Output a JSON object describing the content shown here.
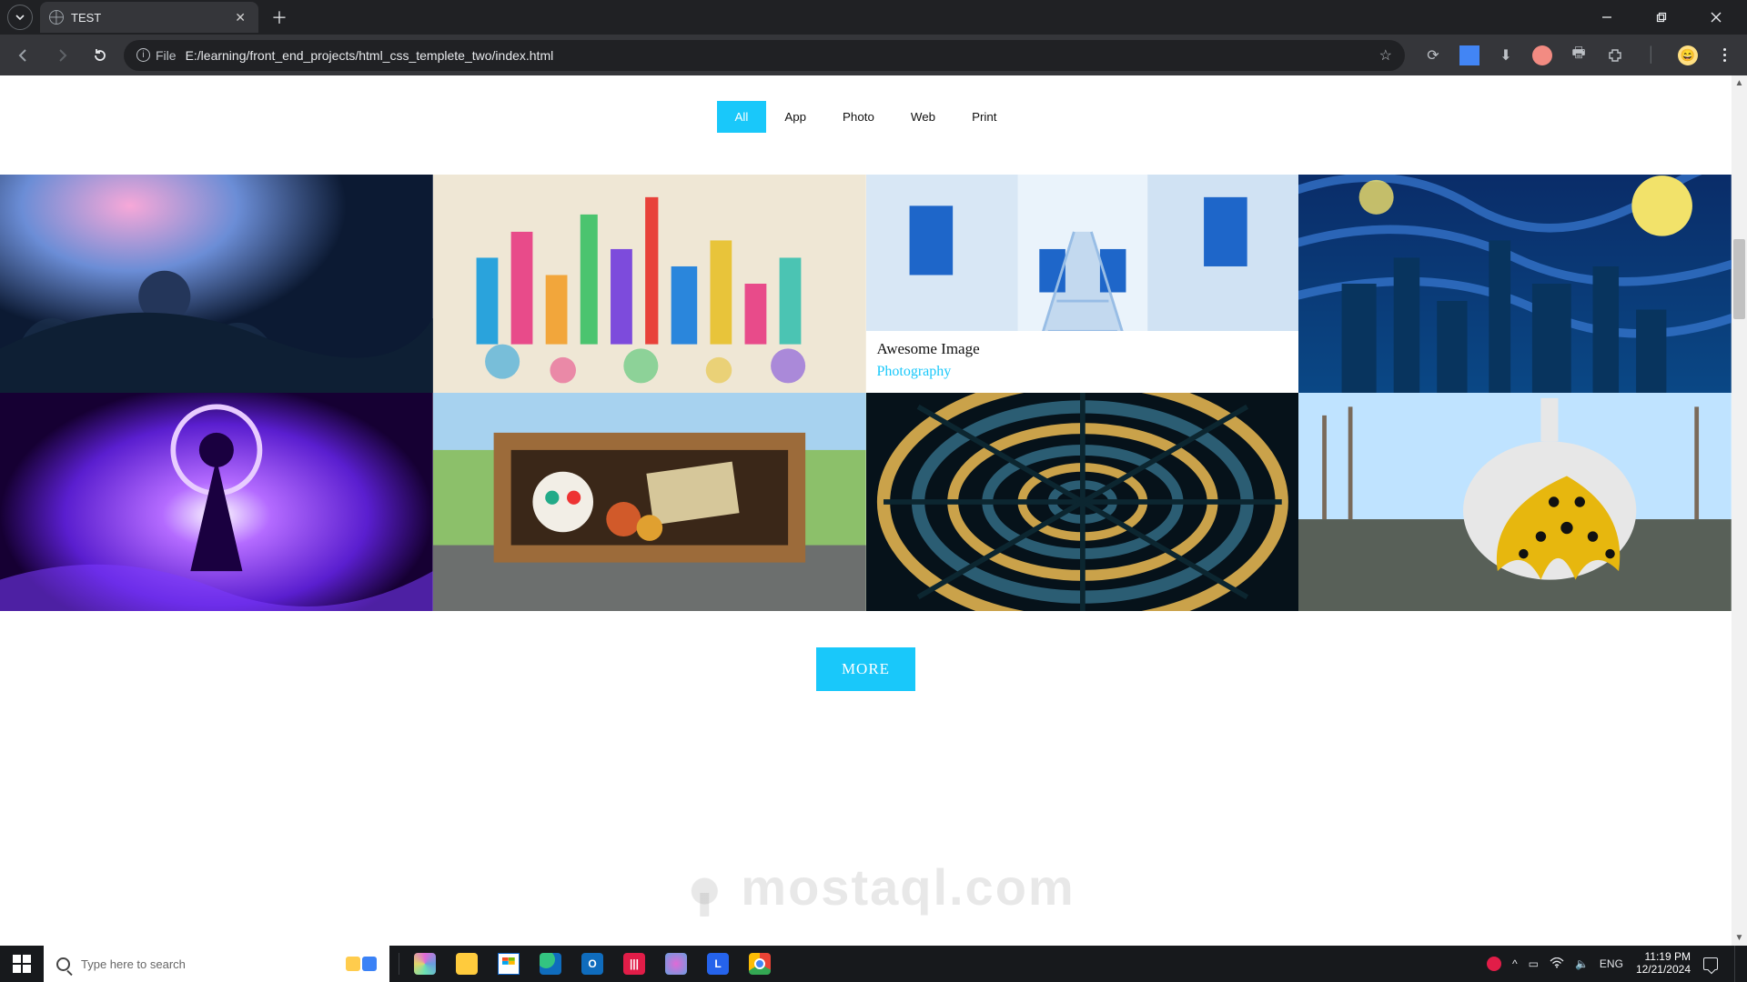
{
  "browser": {
    "tab_title": "TEST",
    "url_label_prefix": "File",
    "url": "E:/learning/front_end_projects/html_css_templete_two/index.html",
    "new_tab_tooltip": "New tab",
    "minimize": "Minimize",
    "restore": "Restore",
    "close": "Close"
  },
  "filters": [
    {
      "label": "All",
      "active": true
    },
    {
      "label": "App",
      "active": false
    },
    {
      "label": "Photo",
      "active": false
    },
    {
      "label": "Web",
      "active": false
    },
    {
      "label": "Print",
      "active": false
    }
  ],
  "gallery": [
    {
      "id": "tile-fantasy-rose-domes",
      "has_caption": false
    },
    {
      "id": "tile-watercolor-skyline",
      "has_caption": false
    },
    {
      "id": "tile-greek-alley",
      "has_caption": true,
      "caption_title": "Awesome Image",
      "caption_category": "Photography"
    },
    {
      "id": "tile-starry-night-city",
      "has_caption": false
    },
    {
      "id": "tile-neon-figure",
      "has_caption": false
    },
    {
      "id": "tile-container-skull",
      "has_caption": false
    },
    {
      "id": "tile-spiral-architecture",
      "has_caption": false
    },
    {
      "id": "tile-kusama-pumpkin",
      "has_caption": false
    }
  ],
  "more_button": "MORE",
  "watermark_text": "mostaql.com",
  "taskbar": {
    "search_placeholder": "Type here to search",
    "pinned": [
      "copilot",
      "file-explorer",
      "microsoft-store",
      "edge",
      "outlook",
      "todo-red",
      "microsoft-365",
      "linkedin",
      "chrome"
    ],
    "lang": "ENG",
    "time": "11:19 PM",
    "date": "12/21/2024"
  },
  "colors": {
    "accent": "#19C8FA"
  }
}
